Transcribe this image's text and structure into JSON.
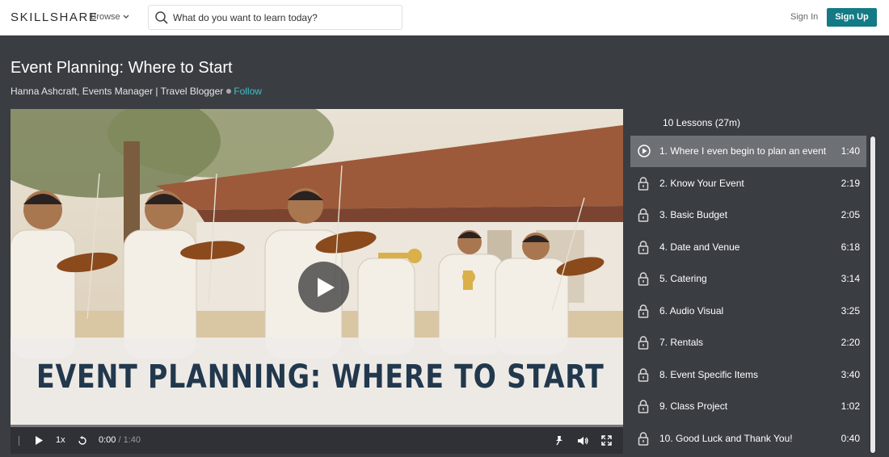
{
  "header": {
    "logo": "SKILLSHARE",
    "browse_label": "Browse",
    "search_placeholder": "What do you want to learn today?",
    "signin_label": "Sign In",
    "signup_label": "Sign Up"
  },
  "course": {
    "title": "Event Planning: Where to Start",
    "instructor": "Hanna Ashcraft, Events Manager | Travel Blogger",
    "follow_label": "Follow"
  },
  "video": {
    "title_card": "EVENT PLANNING: WHERE TO START",
    "speed": "1x",
    "current_time": "0:00",
    "separator": "/",
    "duration": "1:40"
  },
  "lessons": {
    "header": "10 Lessons (27m)",
    "items": [
      {
        "title": "1. Where I even begin to plan an event",
        "duration": "1:40",
        "active": true
      },
      {
        "title": "2. Know Your Event",
        "duration": "2:19"
      },
      {
        "title": "3. Basic Budget",
        "duration": "2:05"
      },
      {
        "title": "4. Date and Venue",
        "duration": "6:18"
      },
      {
        "title": "5. Catering",
        "duration": "3:14"
      },
      {
        "title": "6. Audio Visual",
        "duration": "3:25"
      },
      {
        "title": "7. Rentals",
        "duration": "2:20"
      },
      {
        "title": "8. Event Specific Items",
        "duration": "3:40"
      },
      {
        "title": "9. Class Project",
        "duration": "1:02"
      },
      {
        "title": "10. Good Luck and Thank You!",
        "duration": "0:40"
      }
    ]
  },
  "colors": {
    "accent": "#137a86",
    "follow": "#3fc0c9",
    "page_bg": "#3a3d42",
    "active_row": "#6d7074"
  }
}
